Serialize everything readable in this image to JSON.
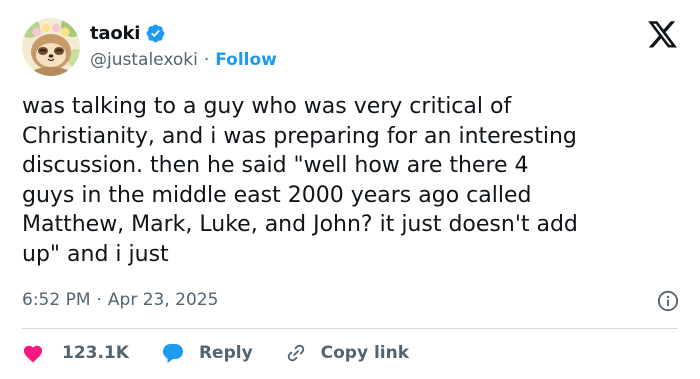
{
  "author": {
    "display_name": "taoki",
    "handle": "@justalexoki",
    "separator": "·",
    "follow_label": "Follow",
    "verified_color": "#1d9bf0"
  },
  "tweet": {
    "text": "was talking to a guy who was very critical of\nChristianity, and i was preparing for an interesting\ndiscussion. then he said \"well how are there 4\nguys in the middle east 2000 years ago called\nMatthew, Mark, Luke, and John? it just doesn't add\nup\" and i just",
    "time": "6:52 PM",
    "separator": "·",
    "date": "Apr 23, 2025"
  },
  "actions": {
    "like_count": "123.1K",
    "reply_label": "Reply",
    "copy_link_label": "Copy link",
    "like_color": "#f91880",
    "reply_color": "#1d9bf0"
  },
  "icons": {
    "avatar": "avatar-icon",
    "verified": "verified-badge-icon",
    "logo": "x-logo-icon",
    "info": "info-icon",
    "like": "heart-icon",
    "reply": "speech-bubble-icon",
    "copy_link": "link-icon"
  }
}
